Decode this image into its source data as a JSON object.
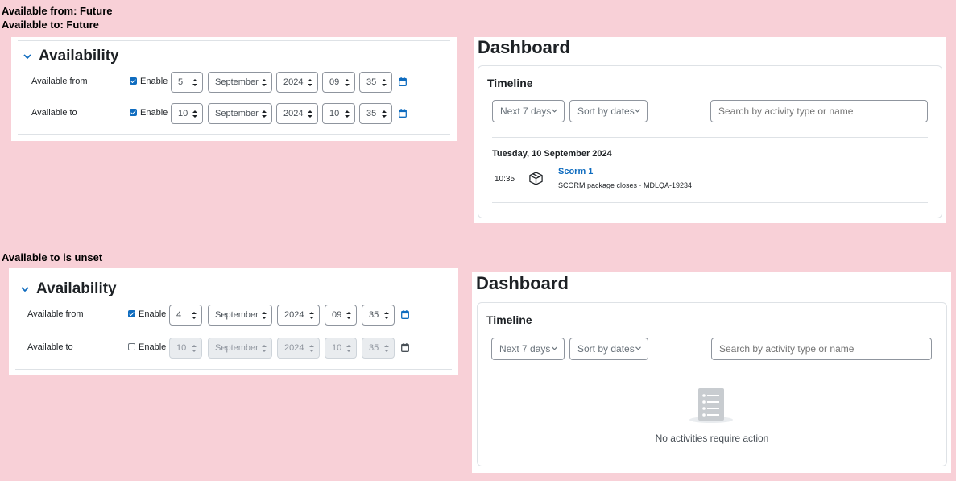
{
  "top_section": {
    "captions": [
      "Available from: Future",
      "Available to: Future"
    ],
    "availability": {
      "title": "Availability",
      "from": {
        "label": "Available from",
        "enable_checked": true,
        "enable_label": "Enable",
        "day": "5",
        "month": "September",
        "year": "2024",
        "hour": "09",
        "minute": "35"
      },
      "to": {
        "label": "Available to",
        "enable_checked": true,
        "enable_label": "Enable",
        "day": "10",
        "month": "September",
        "year": "2024",
        "hour": "10",
        "minute": "35"
      }
    },
    "dashboard": {
      "title": "Dashboard",
      "timeline_title": "Timeline",
      "filter_label": "Next 7 days",
      "sort_label": "Sort by dates",
      "search_placeholder": "Search by activity type or name",
      "date_heading": "Tuesday, 10 September 2024",
      "event": {
        "time": "10:35",
        "name": "Scorm 1",
        "description": "SCORM package closes · MDLQA-19234",
        "icon": "package-box-icon"
      }
    }
  },
  "bottom_section": {
    "caption": "Available to is unset",
    "availability": {
      "title": "Availability",
      "from": {
        "label": "Available from",
        "enable_checked": true,
        "enable_label": "Enable",
        "day": "4",
        "month": "September",
        "year": "2024",
        "hour": "09",
        "minute": "35"
      },
      "to": {
        "label": "Available to",
        "enable_checked": false,
        "enable_label": "Enable",
        "day": "10",
        "month": "September",
        "year": "2024",
        "hour": "10",
        "minute": "35"
      }
    },
    "dashboard": {
      "title": "Dashboard",
      "timeline_title": "Timeline",
      "filter_label": "Next 7 days",
      "sort_label": "Sort by dates",
      "search_placeholder": "Search by activity type or name",
      "empty_message": "No activities require action",
      "empty_icon": "empty-list-icon"
    }
  },
  "colors": {
    "background": "#f8d0d7",
    "accent": "#0f6cbf",
    "text": "#1d2125"
  }
}
